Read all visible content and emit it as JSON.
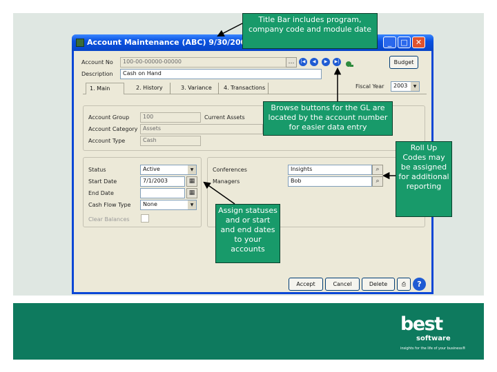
{
  "window": {
    "title": "Account Maintenance (ABC) 9/30/2004",
    "controls": {
      "minimize": "_",
      "maximize": "□",
      "close": "✕"
    }
  },
  "header": {
    "account_no_label": "Account No",
    "account_no_value": "100-00-00000-00000",
    "description_label": "Description",
    "description_value": "Cash on Hand",
    "budget_button": "Budget",
    "fiscal_year_label": "Fiscal Year",
    "fiscal_year_value": "2003"
  },
  "tabs": [
    {
      "label": "1. Main"
    },
    {
      "label": "2. History"
    },
    {
      "label": "3. Variance"
    },
    {
      "label": "4. Transactions"
    }
  ],
  "account_info": {
    "group_label": "Account Group",
    "group_value": "100",
    "current_assets": "Current Assets",
    "category_label": "Account Category",
    "category_value": "Assets",
    "type_label": "Account Type",
    "type_value": "Cash"
  },
  "status_panel": {
    "status_label": "Status",
    "status_value": "Active",
    "start_date_label": "Start Date",
    "start_date_value": "7/1/2003",
    "end_date_label": "End Date",
    "end_date_value": "",
    "cash_flow_label": "Cash Flow Type",
    "cash_flow_value": "None",
    "clear_balances_label": "Clear Balances"
  },
  "rollup_panel": {
    "conferences_label": "Conferences",
    "conferences_value": "Insights",
    "managers_label": "Managers",
    "managers_value": "Bob"
  },
  "footer_buttons": {
    "accept": "Accept",
    "cancel": "Cancel",
    "delete": "Delete"
  },
  "callouts": {
    "title_bar": "Title Bar includes program, company code and module date",
    "browse": "Browse buttons for the GL are located by the account number for easier data entry",
    "rollup": "Roll Up Codes may be assigned for additional reporting",
    "assign": "Assign statuses and or start and end dates to your accounts"
  },
  "brand": {
    "best": "best",
    "software": "software",
    "tagline": "insights for the life of your business®"
  },
  "colors": {
    "callout_green": "#189a6a",
    "footer_green": "#0e7a5e",
    "titlebar_blue": "#0a52e0"
  }
}
